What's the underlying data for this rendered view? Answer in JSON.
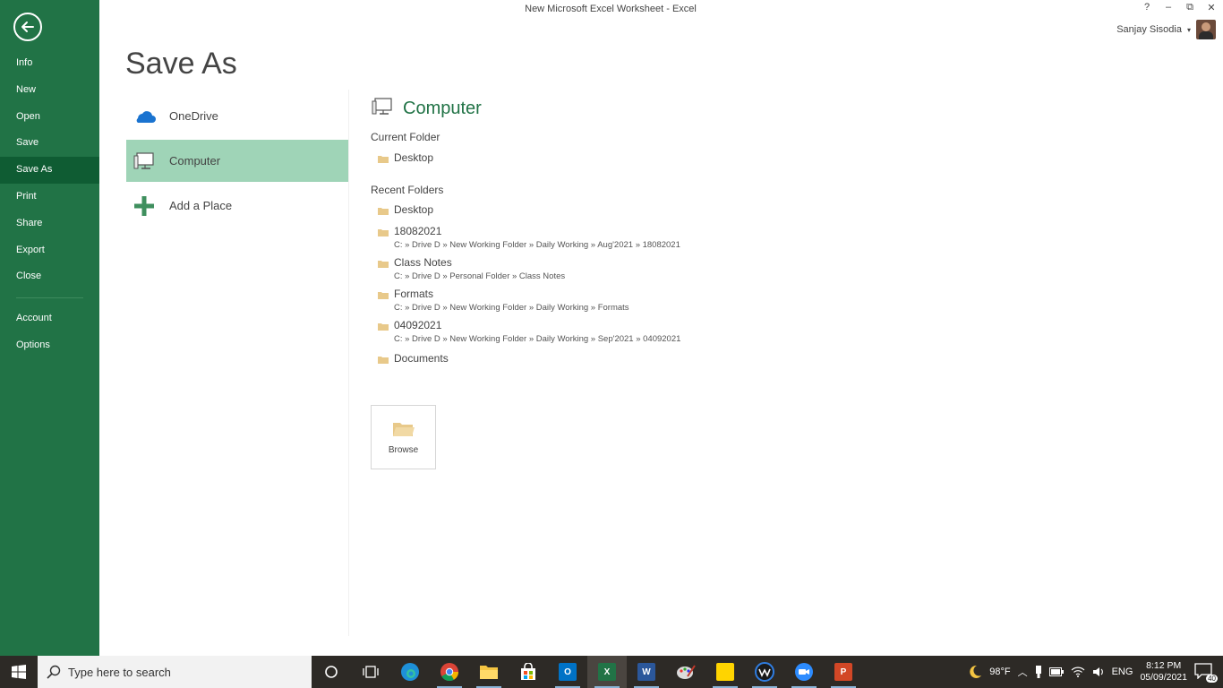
{
  "window": {
    "title": "New Microsoft Excel Worksheet - Excel",
    "controls": [
      "?",
      "–",
      "⧉",
      "✕"
    ],
    "user_name": "Sanjay Sisodia"
  },
  "sidebar": {
    "items": [
      {
        "label": "Info"
      },
      {
        "label": "New"
      },
      {
        "label": "Open"
      },
      {
        "label": "Save"
      },
      {
        "label": "Save As",
        "active": true
      },
      {
        "label": "Print"
      },
      {
        "label": "Share"
      },
      {
        "label": "Export"
      },
      {
        "label": "Close"
      }
    ],
    "bottom_items": [
      {
        "label": "Account"
      },
      {
        "label": "Options"
      }
    ]
  },
  "page": {
    "title": "Save As"
  },
  "places": [
    {
      "label": "OneDrive",
      "icon": "onedrive-icon"
    },
    {
      "label": "Computer",
      "icon": "computer-icon",
      "active": true
    },
    {
      "label": "Add a Place",
      "icon": "plus-icon"
    }
  ],
  "panel": {
    "title": "Computer",
    "current_folder_label": "Current Folder",
    "current_folder": {
      "name": "Desktop"
    },
    "recent_folders_label": "Recent Folders",
    "recent_folders": [
      {
        "name": "Desktop",
        "path": ""
      },
      {
        "name": "18082021",
        "path": "C: » Drive D » New Working Folder » Daily Working » Aug'2021 » 18082021"
      },
      {
        "name": "Class Notes",
        "path": "C: » Drive D » Personal Folder » Class Notes"
      },
      {
        "name": "Formats",
        "path": "C: » Drive D » New Working Folder » Daily Working » Formats"
      },
      {
        "name": "04092021",
        "path": "C: » Drive D » New Working Folder » Daily Working » Sep'2021 » 04092021"
      },
      {
        "name": "Documents",
        "path": ""
      }
    ],
    "browse_label": "Browse"
  },
  "taskbar": {
    "search_placeholder": "Type here to search",
    "weather": "98°F",
    "language": "ENG",
    "time": "8:12 PM",
    "date": "05/09/2021",
    "notification_count": "40"
  },
  "colors": {
    "excel_green": "#217346",
    "sidebar_active": "#0f5c33",
    "place_active": "#9fd4b7"
  }
}
